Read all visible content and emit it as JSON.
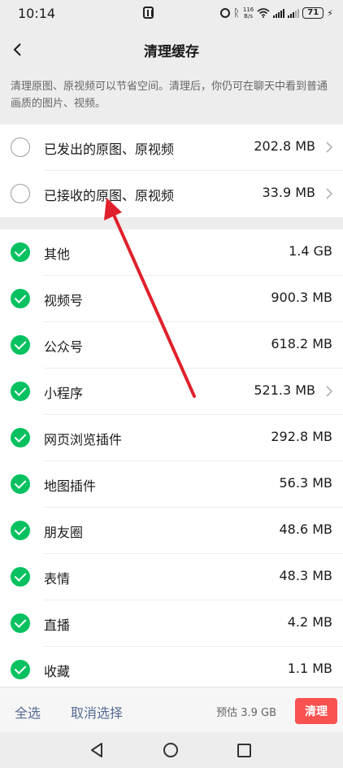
{
  "status_bar": {
    "time": "10:14",
    "speed_value": "116",
    "speed_unit": "B/s",
    "battery": "71"
  },
  "header": {
    "title": "清理缓存"
  },
  "description": "清理原图、原视频可以节省空间。清理后，你仍可在聊天中看到普通画质的图片、视频。",
  "original_media": [
    {
      "label": "已发出的原图、原视频",
      "size": "202.8 MB",
      "checked": false,
      "has_arrow": true
    },
    {
      "label": "已接收的原图、原视频",
      "size": "33.9 MB",
      "checked": false,
      "has_arrow": true
    }
  ],
  "categories": [
    {
      "label": "其他",
      "size": "1.4 GB",
      "checked": true,
      "has_arrow": false
    },
    {
      "label": "视频号",
      "size": "900.3 MB",
      "checked": true,
      "has_arrow": false
    },
    {
      "label": "公众号",
      "size": "618.2 MB",
      "checked": true,
      "has_arrow": false
    },
    {
      "label": "小程序",
      "size": "521.3 MB",
      "checked": true,
      "has_arrow": true
    },
    {
      "label": "网页浏览插件",
      "size": "292.8 MB",
      "checked": true,
      "has_arrow": false
    },
    {
      "label": "地图插件",
      "size": "56.3 MB",
      "checked": true,
      "has_arrow": false
    },
    {
      "label": "朋友圈",
      "size": "48.6 MB",
      "checked": true,
      "has_arrow": false
    },
    {
      "label": "表情",
      "size": "48.3 MB",
      "checked": true,
      "has_arrow": false
    },
    {
      "label": "直播",
      "size": "4.2 MB",
      "checked": true,
      "has_arrow": false
    },
    {
      "label": "收藏",
      "size": "1.1 MB",
      "checked": true,
      "has_arrow": false
    }
  ],
  "bottom_bar": {
    "select_all": "全选",
    "deselect": "取消选择",
    "estimate": "预估 3.9 GB",
    "clean": "清理"
  },
  "colors": {
    "accent_green": "#07c160",
    "danger_red": "#fa5151",
    "link_blue": "#576b95",
    "annotation_red": "#e0202a"
  }
}
